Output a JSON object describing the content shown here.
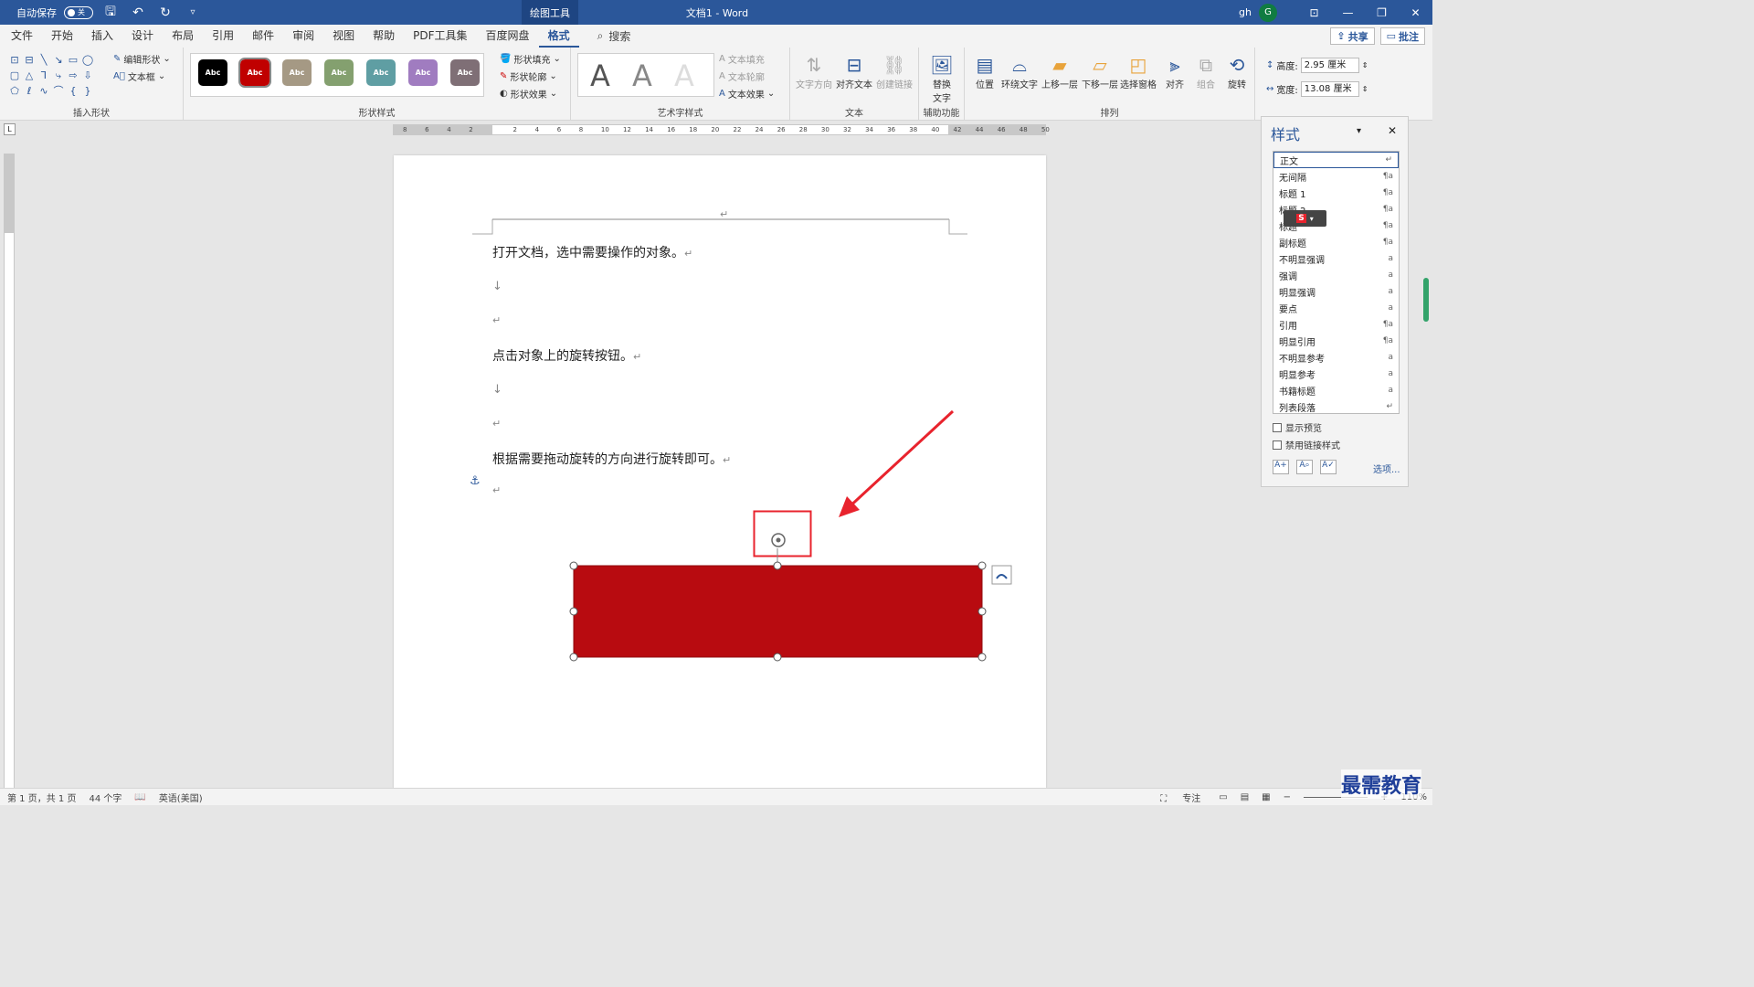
{
  "titlebar": {
    "autosave_label": "自动保存",
    "autosave_state": "关",
    "tool_tab": "绘图工具",
    "doc_title": "文档1  -  Word",
    "user": "gh",
    "avatar_initial": "G"
  },
  "menu": {
    "tabs": [
      "文件",
      "开始",
      "插入",
      "设计",
      "布局",
      "引用",
      "邮件",
      "审阅",
      "视图",
      "帮助",
      "PDF工具集",
      "百度网盘",
      "格式"
    ],
    "active_tab": "格式",
    "search": "搜索",
    "share": "共享",
    "comments": "批注"
  },
  "ribbon": {
    "insert_shapes": {
      "label": "插入形状",
      "edit_shape": "编辑形状",
      "text_box": "文本框"
    },
    "shape_styles": {
      "label": "形状样式",
      "swatch_text": "Abc",
      "swatches": [
        "#000000",
        "#c00000",
        "#a59984",
        "#84a06f",
        "#5f9ea3",
        "#a07cc0",
        "#7f6f76"
      ],
      "fill": "形状填充",
      "outline": "形状轮廓",
      "effects": "形状效果"
    },
    "wordart": {
      "label": "艺术字样式",
      "letter": "A",
      "text_fill": "文本填充",
      "text_outline": "文本轮廓",
      "text_effects": "文本效果"
    },
    "text_group": {
      "label": "文本",
      "direction": "文字方向",
      "align_text": "对齐文本",
      "create_link": "创建链接"
    },
    "accessibility": {
      "label": "辅助功能",
      "alt_text_1": "替换",
      "alt_text_2": "文字"
    },
    "arrange": {
      "label": "排列",
      "position": "位置",
      "wrap_text": "环绕文字",
      "bring_forward": "上移一层",
      "send_backward": "下移一层",
      "selection_pane": "选择窗格",
      "align": "对齐",
      "group": "组合",
      "rotate": "旋转"
    },
    "size": {
      "height_label": "高度:",
      "height_value": "2.95 厘米",
      "width_label": "宽度:",
      "width_value": "13.08 厘米"
    }
  },
  "ruler": {
    "corner": "L",
    "numbers": [
      "8",
      "6",
      "4",
      "2",
      "",
      "2",
      "4",
      "6",
      "8",
      "10",
      "12",
      "14",
      "16",
      "18",
      "20",
      "22",
      "24",
      "26",
      "28",
      "30",
      "32",
      "34",
      "36",
      "38",
      "40",
      "42",
      "44",
      "46",
      "48",
      "50"
    ]
  },
  "document": {
    "line1": "打开文档，选中需要操作的对象。",
    "line2": "点击对象上的旋转按钮。",
    "line3": "根据需要拖动旋转的方向进行旋转即可。",
    "para_mark": "↵",
    "line_break": "↓",
    "shape_color": "#b80b10",
    "highlight_color": "#e8232d"
  },
  "styles_pane": {
    "title": "样式",
    "items": [
      {
        "name": "正文",
        "sym": "↵"
      },
      {
        "name": "无间隔",
        "sym": "¶a"
      },
      {
        "name": "标题 1",
        "sym": "¶a"
      },
      {
        "name": "标题 2",
        "sym": "¶a"
      },
      {
        "name": "标题",
        "sym": "¶a"
      },
      {
        "name": "副标题",
        "sym": "¶a"
      },
      {
        "name": "不明显强调",
        "sym": "a"
      },
      {
        "name": "强调",
        "sym": "a"
      },
      {
        "name": "明显强调",
        "sym": "a"
      },
      {
        "name": "要点",
        "sym": "a"
      },
      {
        "name": "引用",
        "sym": "¶a"
      },
      {
        "name": "明显引用",
        "sym": "¶a"
      },
      {
        "name": "不明显参考",
        "sym": "a"
      },
      {
        "name": "明显参考",
        "sym": "a"
      },
      {
        "name": "书籍标题",
        "sym": "a"
      },
      {
        "name": "列表段落",
        "sym": "↵"
      }
    ],
    "show_preview": "显示预览",
    "disable_linked": "禁用链接样式",
    "options": "选项..."
  },
  "statusbar": {
    "page": "第 1 页，共 1 页",
    "words": "44 个字",
    "language": "英语(美国)",
    "focus": "专注",
    "zoom": "110%"
  },
  "watermark": "最需教育"
}
